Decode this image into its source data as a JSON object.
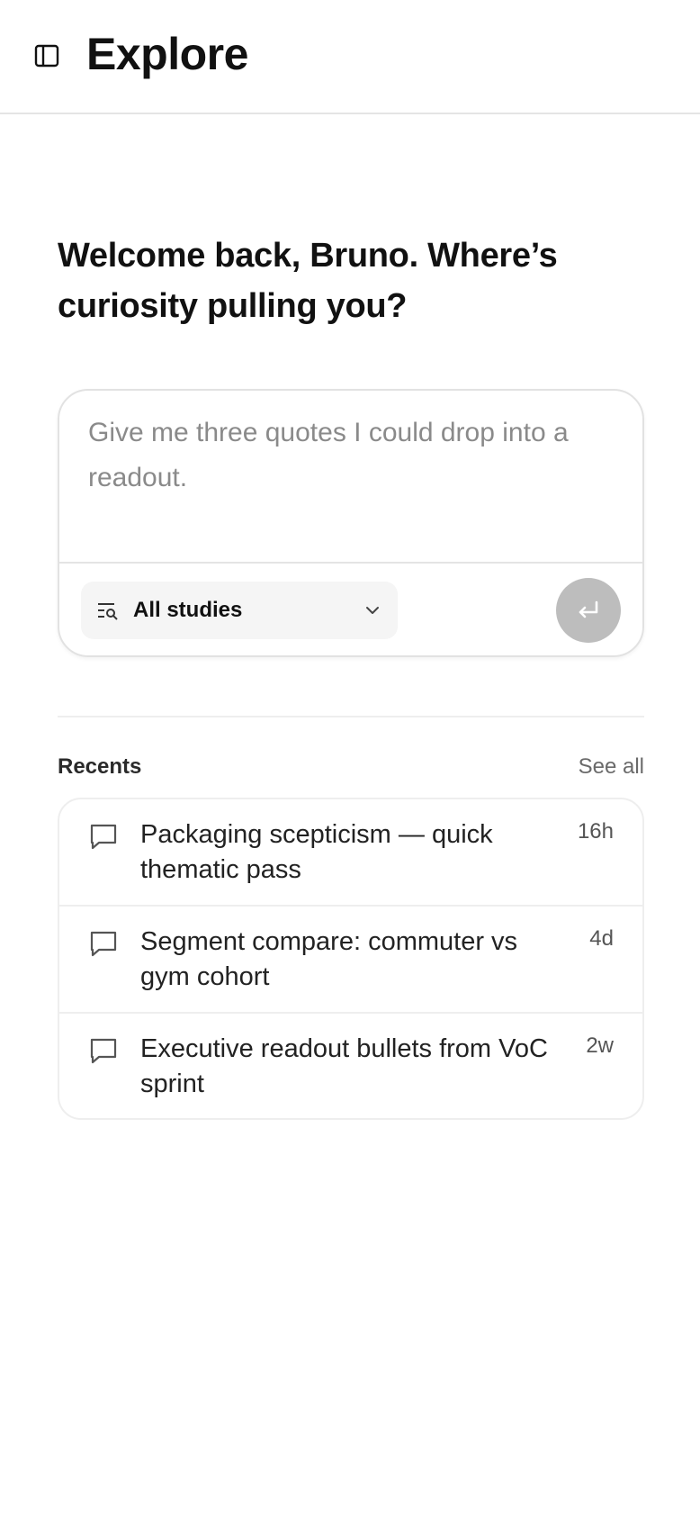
{
  "header": {
    "title": "Explore",
    "sidebar_icon": "sidebar-panel-icon"
  },
  "welcome": {
    "line1": "Welcome back, Bruno. Where’s",
    "line2": "curiosity pulling you?"
  },
  "composer": {
    "placeholder": "Give me three quotes I could drop into a readout.",
    "value": "",
    "study_filter": {
      "icon": "filter-search-icon",
      "selected": "All studies"
    },
    "send_icon": "enter-arrow-icon"
  },
  "recents": {
    "title": "Recents",
    "see_all": "See all",
    "items": [
      {
        "title": "Packaging scepticism — quick thematic pass",
        "time": "16h",
        "icon": "chat-bubble-icon"
      },
      {
        "title": "Segment compare: commuter vs gym cohort",
        "time": "4d",
        "icon": "chat-bubble-icon"
      },
      {
        "title": "Executive readout bullets from VoC sprint",
        "time": "2w",
        "icon": "chat-bubble-icon"
      }
    ]
  },
  "colors": {
    "text": "#111111",
    "muted": "#6a6a6a",
    "border": "#e4e4e4",
    "send_disabled": "#bdbdbd",
    "select_bg": "#f5f5f5"
  }
}
